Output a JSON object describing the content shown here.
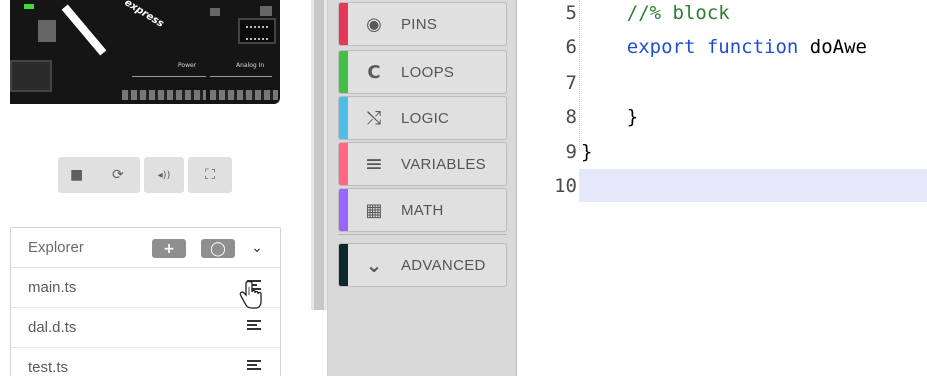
{
  "board": {
    "brand_text": "express",
    "power_label": "Power",
    "analog_label": "Analog In"
  },
  "simulator_toolbar": {
    "buttons": [
      {
        "name": "stop",
        "glyph": "■"
      },
      {
        "name": "restart",
        "glyph": "⟳"
      },
      {
        "name": "mute",
        "glyph": "◂))"
      },
      {
        "name": "fullscreen",
        "glyph": "⛶"
      }
    ]
  },
  "explorer": {
    "title": "Explorer",
    "add_glyph": "+",
    "github_glyph": "◯",
    "chevron_glyph": "⌄",
    "files": [
      "main.ts",
      "dal.d.ts",
      "test.ts"
    ]
  },
  "toolbox": {
    "categories": [
      {
        "label": "PINS",
        "color": "#e6375b",
        "icon": "pins-icon",
        "glyph": "◉"
      },
      {
        "label": "LOOPS",
        "color": "#40bf4a",
        "icon": "loops-icon",
        "glyph": "C"
      },
      {
        "label": "LOGIC",
        "color": "#4cbfe6",
        "icon": "logic-icon",
        "glyph": "⤭"
      },
      {
        "label": "VARIABLES",
        "color": "#ff6680",
        "icon": "variables-icon",
        "glyph": "≡"
      },
      {
        "label": "MATH",
        "color": "#9966ff",
        "icon": "math-icon",
        "glyph": "▦"
      },
      {
        "label": "ADVANCED",
        "color": "#0c2a2a",
        "icon": "chevron-down-icon",
        "glyph": "⌄"
      }
    ]
  },
  "editor": {
    "line_numbers": [
      "5",
      "6",
      "7",
      "8",
      "9",
      "10"
    ],
    "lines": [
      {
        "text": "    //% block",
        "class": "cm"
      },
      {
        "kw": "    export function ",
        "fn": "doAwe"
      },
      {
        "text": "",
        "class": "fn"
      },
      {
        "text": "    }",
        "class": "fn"
      },
      {
        "text": "}",
        "class": "fn"
      },
      {
        "text": "",
        "class": "fn"
      }
    ],
    "active_line": "10"
  }
}
